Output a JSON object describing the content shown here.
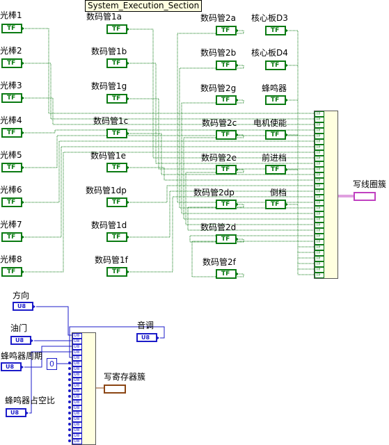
{
  "title": "System_Execution_Section",
  "left_controls": [
    "光棒1",
    "光棒2",
    "光棒3",
    "光棒4",
    "光棒5",
    "光棒6",
    "光棒7",
    "光棒8"
  ],
  "mid_controls": [
    "数码管1a",
    "数码管1b",
    "数码管1g",
    "数码管1c",
    "数码管1e",
    "数码管1dp",
    "数码管1d",
    "数码管1f"
  ],
  "right_controls": [
    "数码管2a",
    "数码管2b",
    "数码管2g",
    "数码管2c",
    "数码管2e",
    "数码管2dp",
    "数码管2d",
    "数码管2f"
  ],
  "far_controls": [
    "核心板D3",
    "核心板D4",
    "蜂鸣器",
    "电机使能",
    "前进档",
    "倒档"
  ],
  "bool_glyph": "TF",
  "u8_glyph": "U8",
  "u8_controls": [
    "方向",
    "油门",
    "蜂鸣器周期",
    "蜂鸣器占空比",
    "音调"
  ],
  "const_zero": "0",
  "indicator_top": "写线圈簇",
  "indicator_bottom": "写寄存器簇",
  "colors": {
    "bool": "#0a7a12",
    "u8": "#1b1bc9",
    "cluster_wire": "#c040c0",
    "cluster2_wire": "#8b4513"
  }
}
